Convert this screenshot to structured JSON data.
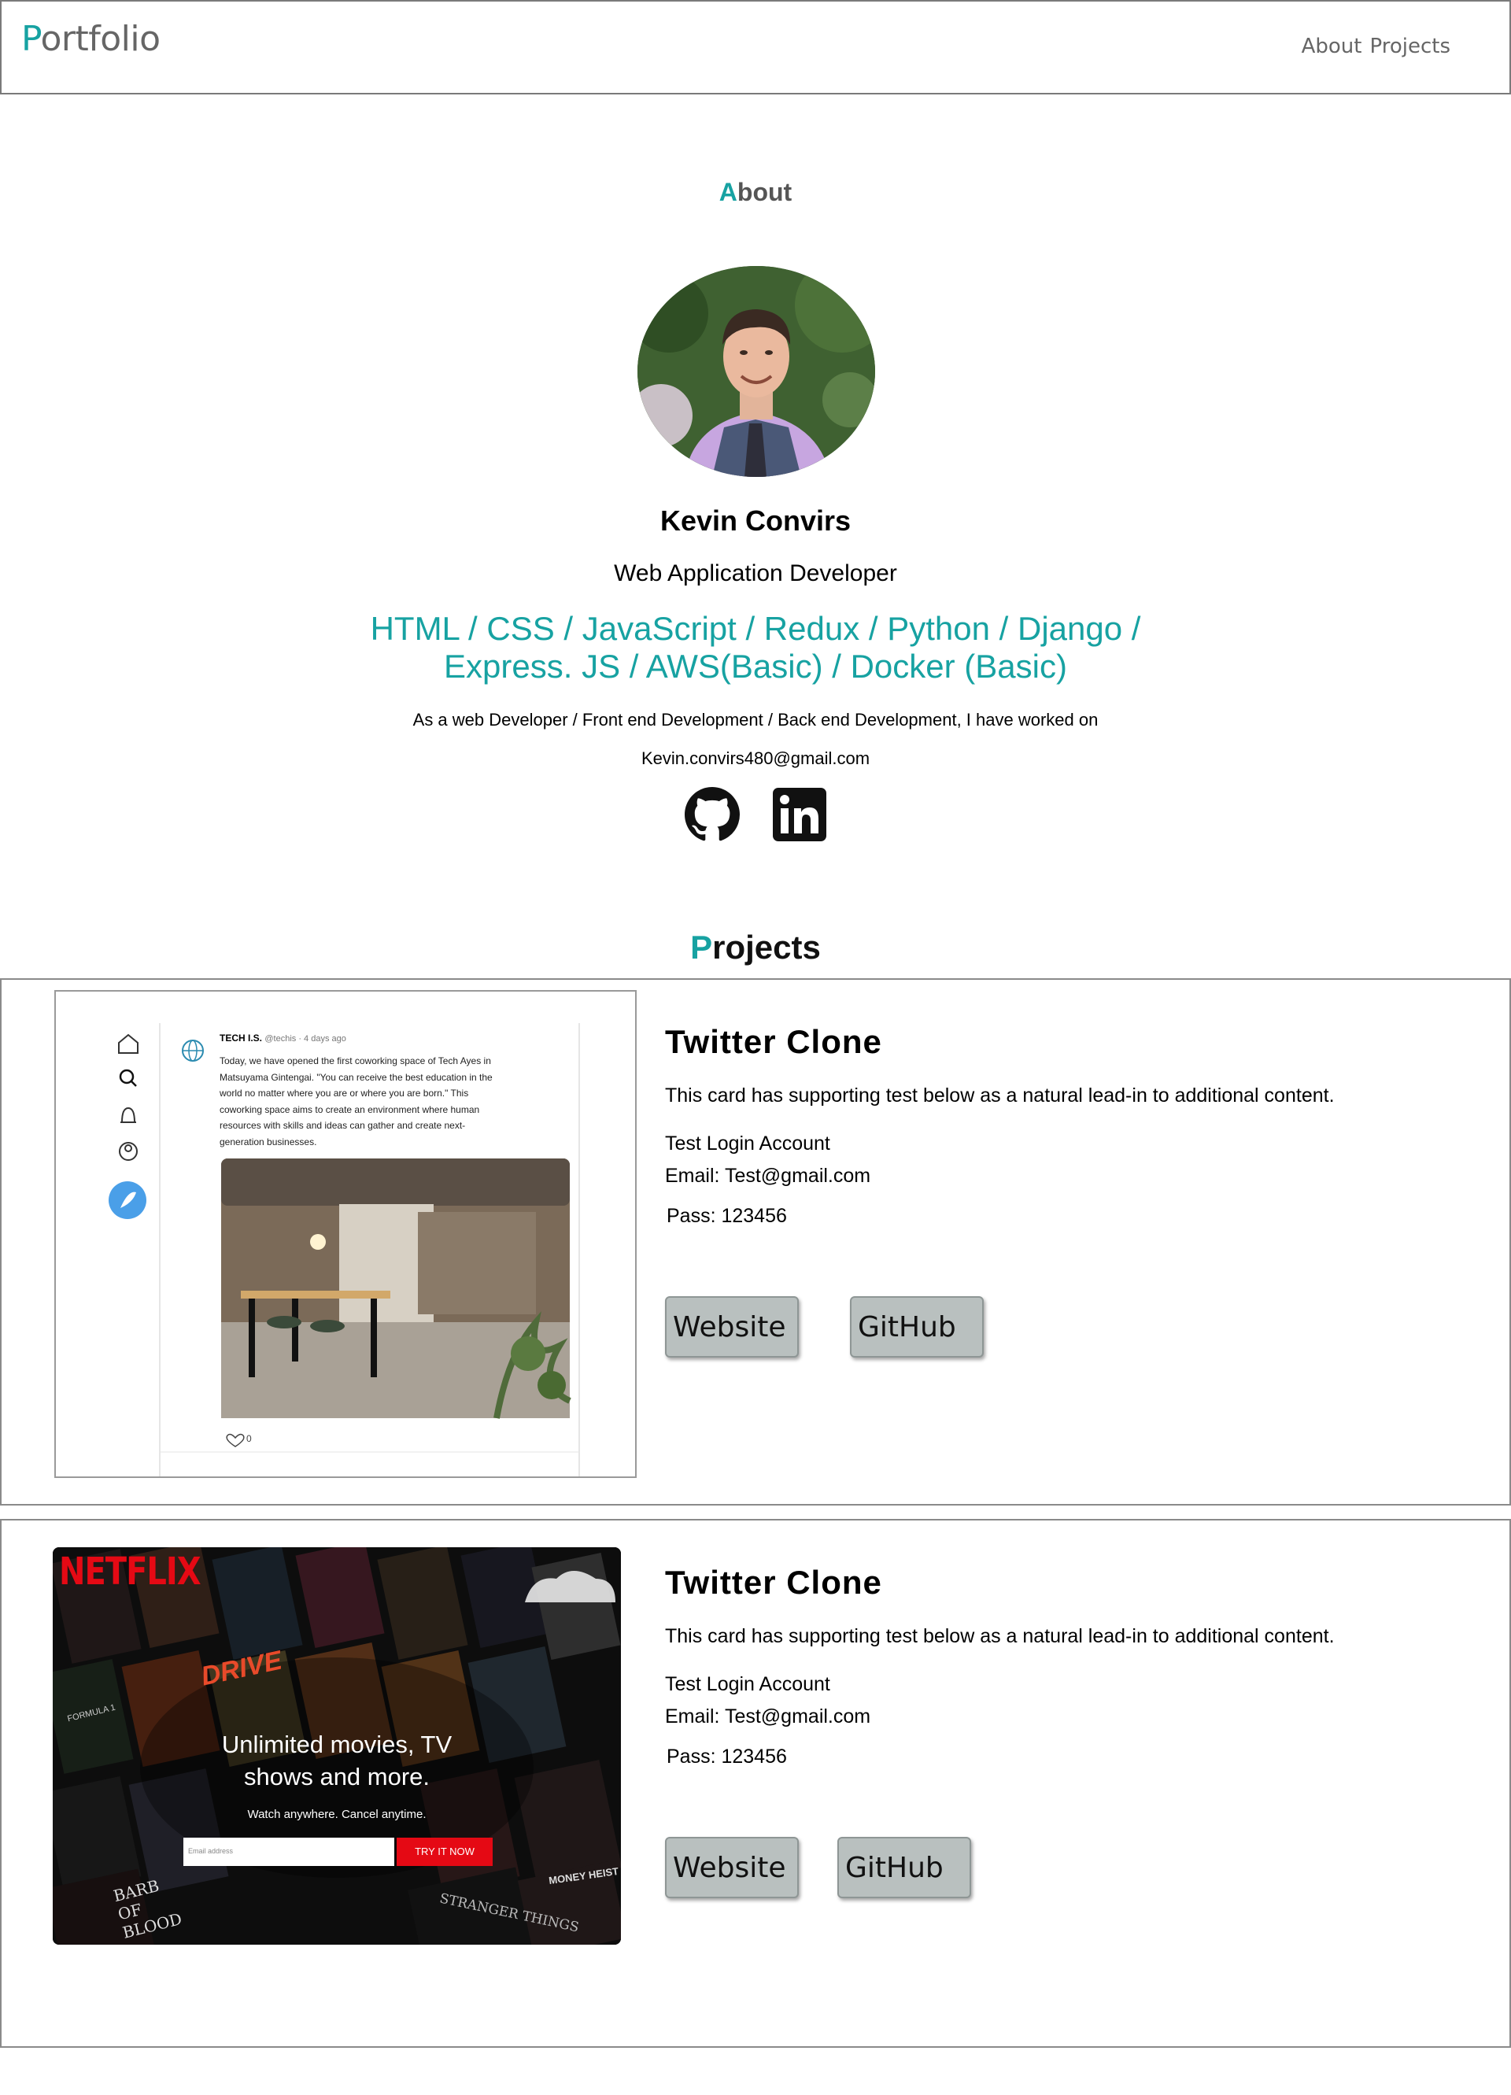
{
  "nav": {
    "brand_first": "P",
    "brand_rest": "ortfolio",
    "links": [
      "About",
      "Projects"
    ]
  },
  "about": {
    "title_first": "A",
    "title_rest": "bout",
    "name": "Kevin Convirs",
    "role": "Web Application Developer",
    "skills_line1": "HTML / CSS / JavaScript / Redux / Python / Django /",
    "skills_line2": "Express. JS / AWS(Basic) / Docker (Basic)",
    "description": "As a web Developer / Front end Development / Back end Development, I have worked on",
    "email": "Kevin.convirs480@gmail.com",
    "social": [
      "github-icon",
      "linkedin-icon"
    ]
  },
  "projects": {
    "title_first": "P",
    "title_rest": "rojects",
    "cards": [
      {
        "title": "Twitter Clone",
        "text": "This card has supporting test below as a natural lead-in to additional content.",
        "login_label": "Test Login Account",
        "email_line": "Email: Test@gmail.com",
        "pass_line": "Pass: 123456",
        "website_label": "Website",
        "github_label": "GitHub",
        "preview": {
          "account": "TECH I.S.",
          "handle": "@techis · 4 days ago",
          "tweet": [
            "Today, we have opened the first coworking space of Tech Ayes in",
            "Matsuyama Gintengai. \"You can receive the best education in the",
            "world no matter where you are or where you are born.\" This",
            "coworking space aims to create an environment where human",
            "resources with skills and ideas can gather and create next-",
            "generation businesses."
          ],
          "likes": "0"
        }
      },
      {
        "title": "Twitter Clone",
        "text": "This card has supporting test below as a natural lead-in to additional content.",
        "login_label": "Test Login Account",
        "email_line": "Email: Test@gmail.com",
        "pass_line": "Pass: 123456",
        "website_label": "Website",
        "github_label": "GitHub",
        "preview": {
          "logo": "NETFLIX",
          "headline1": "Unlimited movies, TV",
          "headline2": "shows and more.",
          "sub": "Watch anywhere. Cancel anytime.",
          "email_placeholder": "Email address",
          "cta": "TRY IT NOW",
          "poster_texts": [
            "DRIVE",
            "BARB OF BLOOD",
            "STRANGER THINGS",
            "MONEY HEIST",
            "FORMULA 1"
          ]
        }
      }
    ]
  },
  "colors": {
    "accent": "#17a2a2",
    "button": "#b9c0bf",
    "netflix_red": "#e50914"
  }
}
